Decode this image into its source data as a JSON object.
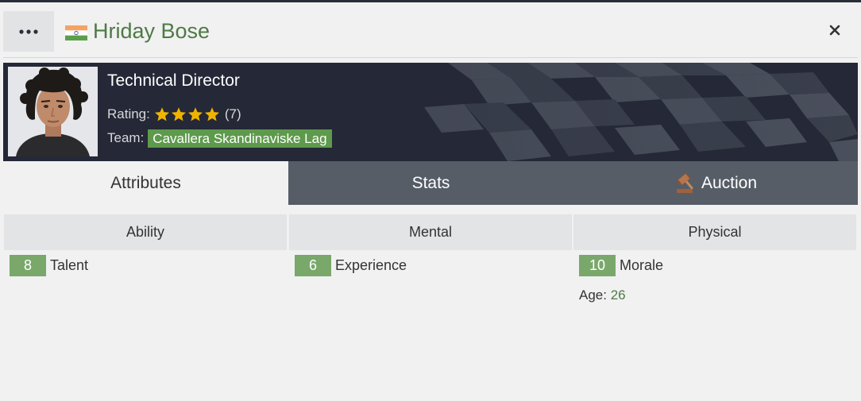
{
  "header": {
    "name": "Hriday Bose",
    "flag_icon": "india-flag-icon",
    "menu_icon": "ellipsis-icon",
    "close_icon": "close-icon"
  },
  "profile": {
    "role": "Technical Director",
    "rating_label": "Rating:",
    "rating_stars": 4,
    "rating_value": "(7)",
    "team_label": "Team:",
    "team_name": "Cavallera Skandinaviske Lag"
  },
  "tabs": [
    {
      "label": "Attributes",
      "active": true
    },
    {
      "label": "Stats",
      "active": false
    },
    {
      "label": "Auction",
      "active": false,
      "icon": "gavel-icon"
    }
  ],
  "attributes": {
    "ability": {
      "title": "Ability",
      "items": [
        {
          "value": "8",
          "label": "Talent"
        }
      ]
    },
    "mental": {
      "title": "Mental",
      "items": [
        {
          "value": "6",
          "label": "Experience"
        }
      ]
    },
    "physical": {
      "title": "Physical",
      "items": [
        {
          "value": "10",
          "label": "Morale"
        }
      ]
    },
    "age_label": "Age:",
    "age_value": "26"
  },
  "colors": {
    "accent_green": "#4d7a44",
    "badge_green": "#79a86a",
    "team_badge": "#5e9a4c",
    "banner": "#242837",
    "tab_inactive": "#575d67",
    "star": "#f0b400"
  }
}
